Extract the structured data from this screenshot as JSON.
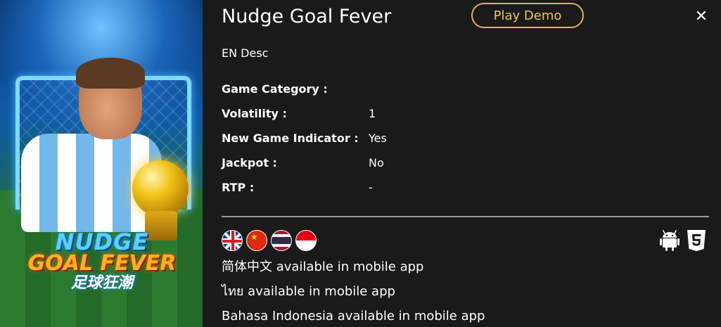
{
  "game": {
    "title": "Nudge Goal Fever",
    "description": "EN Desc",
    "play_demo_label": "Play Demo",
    "close_icon": "close-icon",
    "artwork": {
      "logo_line1": "NUDGE",
      "logo_line2": "GOAL FEVER",
      "logo_line3": "足球狂潮"
    }
  },
  "info": [
    {
      "label": "Game Category :",
      "value": ""
    },
    {
      "label": "Volatility :",
      "value": "1"
    },
    {
      "label": "New Game Indicator :",
      "value": "Yes"
    },
    {
      "label": "Jackpot :",
      "value": "No"
    },
    {
      "label": "RTP :",
      "value": "-"
    }
  ],
  "languages": {
    "flags": [
      "uk-flag-icon",
      "china-flag-icon",
      "thailand-flag-icon",
      "indonesia-flag-icon"
    ],
    "availability": [
      "简体中文 available in mobile app",
      "ไทย available in mobile app",
      "Bahasa Indonesia available in mobile app"
    ]
  },
  "platforms": [
    "android-icon",
    "html5-icon"
  ],
  "colors": {
    "background": "#1a1a1a",
    "accent": "#e3b53f",
    "text": "#ffffff",
    "divider": "#9a9a9a"
  }
}
